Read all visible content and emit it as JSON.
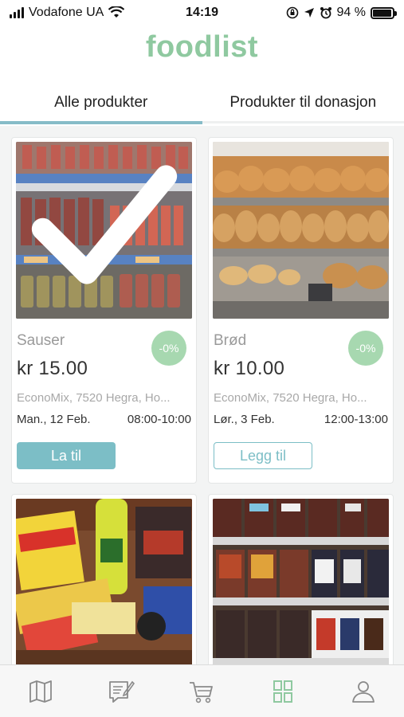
{
  "status_bar": {
    "carrier": "Vodafone UA",
    "time": "14:19",
    "battery": "94 %",
    "battery_level": 0.94,
    "icons": [
      "signal-icon",
      "wifi-icon",
      "screen-lock-icon",
      "location-icon",
      "alarm-icon",
      "battery-icon"
    ]
  },
  "app": {
    "logo": "foodlist",
    "brand_color": "#8fc9a0",
    "accent_color": "#7cbec6"
  },
  "tabs": [
    {
      "label": "Alle produkter",
      "active": true
    },
    {
      "label": "Produkter til donasjon",
      "active": false
    }
  ],
  "products": [
    {
      "name": "Sauser",
      "discount": "-0%",
      "price": "kr 15.00",
      "address": "EconoMix, 7520 Hegra, Ho...",
      "date": "Man., 12 Feb.",
      "time": "08:00-10:00",
      "button": "La til",
      "added": true,
      "image": "sauces-shelf"
    },
    {
      "name": "Brød",
      "discount": "-0%",
      "price": "kr 10.00",
      "address": "EconoMix, 7520 Hegra, Ho...",
      "date": "Lør., 3 Feb.",
      "time": "12:00-13:00",
      "button": "Legg til",
      "added": false,
      "image": "bread-shelf"
    },
    {
      "image": "snacks-pile"
    },
    {
      "image": "chocolate-shelf"
    }
  ],
  "tab_bar": [
    {
      "icon": "map-icon",
      "active": false
    },
    {
      "icon": "edit-note-icon",
      "active": false
    },
    {
      "icon": "cart-icon",
      "active": false
    },
    {
      "icon": "grid-icon",
      "active": true
    },
    {
      "icon": "user-icon",
      "active": false
    }
  ]
}
